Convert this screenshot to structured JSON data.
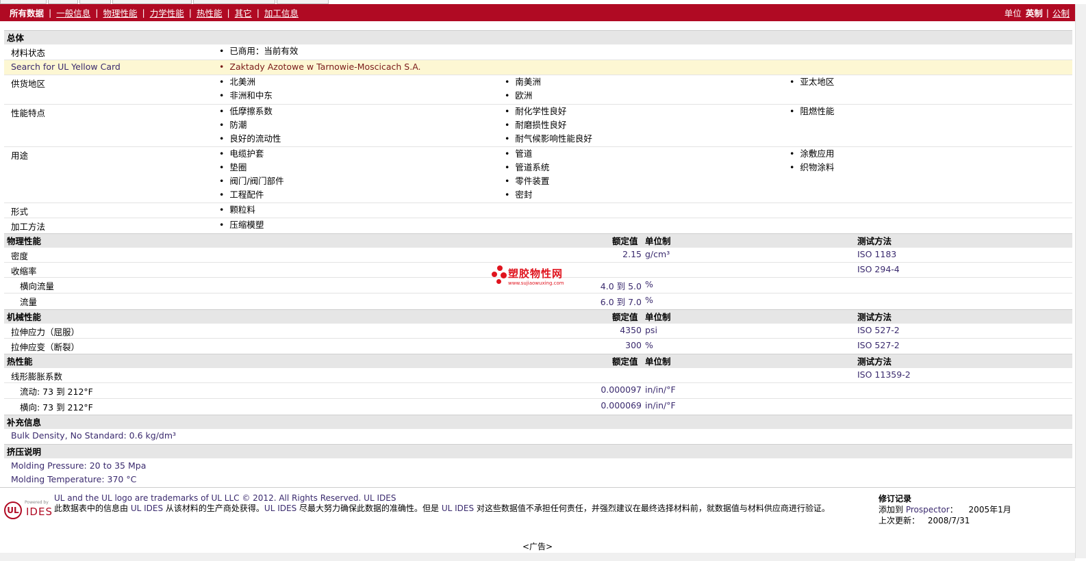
{
  "nav": {
    "links": [
      "所有数据",
      "一般信息",
      "物理性能",
      "力学性能",
      "热性能",
      "其它",
      "加工信息"
    ],
    "active_index": 0,
    "unit_label": "单位",
    "unit_selected": "英制",
    "unit_sep": "|",
    "unit_other": "公制"
  },
  "general": {
    "section_title": "总体",
    "material_status": {
      "label": "材料状态",
      "value": "已商用：当前有效"
    },
    "yellow_card": {
      "label": "Search for UL Yellow Card",
      "value": "Zaktady Azotowe w Tarnowie-Moscicach S.A."
    },
    "supply_regions": {
      "label": "供货地区",
      "col1": [
        "北美洲",
        "非洲和中东"
      ],
      "col2": [
        "南美洲",
        "欧洲"
      ],
      "col3": [
        "亚太地区"
      ]
    },
    "features": {
      "label": "性能特点",
      "col1": [
        "低摩擦系数",
        "防潮",
        "良好的流动性"
      ],
      "col2": [
        "耐化学性良好",
        "耐磨损性良好",
        "耐气候影响性能良好"
      ],
      "col3": [
        "阻燃性能"
      ]
    },
    "uses": {
      "label": "用途",
      "col1": [
        "电缆护套",
        "垫圈",
        "阀门/阀门部件",
        "工程配件"
      ],
      "col2": [
        "管道",
        "管道系统",
        "零件装置",
        "密封"
      ],
      "col3": [
        "涂敷应用",
        "织物涂料"
      ]
    },
    "form": {
      "label": "形式",
      "col1": [
        "颗粒料"
      ]
    },
    "processing": {
      "label": "加工方法",
      "col1": [
        "压缩模塑"
      ]
    }
  },
  "headers": {
    "value": "额定值",
    "unit": "单位制",
    "method": "测试方法"
  },
  "physical": {
    "section_title": "物理性能",
    "density": {
      "label": "密度",
      "value": "2.15",
      "unit": "g/cm³",
      "method": "ISO 1183"
    },
    "shrinkage": {
      "label": "收缩率",
      "method": "ISO 294-4"
    },
    "shrink_td": {
      "label": "横向流量",
      "value": "4.0 到  5.0",
      "unit": "%"
    },
    "shrink_flow": {
      "label": "流量",
      "value": "6.0 到  7.0",
      "unit": "%"
    }
  },
  "mechanical": {
    "section_title": "机械性能",
    "tensile_stress": {
      "label": "拉伸应力（屈服）",
      "value": "4350",
      "unit": "psi",
      "method": "ISO 527-2"
    },
    "tensile_strain": {
      "label": "拉伸应变（断裂）",
      "value": "300",
      "unit": "%",
      "method": "ISO 527-2"
    }
  },
  "thermal": {
    "section_title": "热性能",
    "clte": {
      "label": "线形膨胀系数",
      "method": "ISO 11359-2"
    },
    "clte_flow": {
      "label": "流动: 73 到  212°F",
      "value": "0.000097",
      "unit": "in/in/°F"
    },
    "clte_td": {
      "label": "横向: 73 到  212°F",
      "value": "0.000069",
      "unit": "in/in/°F"
    }
  },
  "supplement": {
    "section_title": "补充信息",
    "text": "Bulk Density, No Standard: 0.6 kg/dm³"
  },
  "extrusion": {
    "section_title": "挤压说明",
    "line1": "Molding Pressure: 20 to 35 Mpa",
    "line2": "Molding Temperature: 370 °C"
  },
  "watermark": {
    "name": "塑胶物性网",
    "url": "www.sujiaowuxing.com"
  },
  "footer": {
    "logo_powered": "Powered by",
    "logo_ul": "UL",
    "logo_ides": "IDES",
    "trademark": "UL and the UL logo are trademarks of UL LLC © 2012. All Rights Reserved. UL IDES",
    "disclaimer_a": "此数据表中的信息由 ",
    "disclaimer_ul1": "UL IDES",
    "disclaimer_b": " 从该材料的生产商处获得。",
    "disclaimer_ul2": "UL IDES",
    "disclaimer_c": " 尽最大努力确保此数据的准确性。但是 ",
    "disclaimer_ul3": "UL IDES",
    "disclaimer_d": " 对这些数据值不承担任何责任，并强烈建议在最终选择材料前，就数据值与材料供应商进行验证。",
    "revision_title": "修订记录",
    "added_label": "添加到 ",
    "added_target": "Prospector",
    "added_colon": "：",
    "added_date": "2005年1月",
    "updated_label": "上次更新：",
    "updated_date": "2008/7/31"
  },
  "ad_label": "<广告>"
}
